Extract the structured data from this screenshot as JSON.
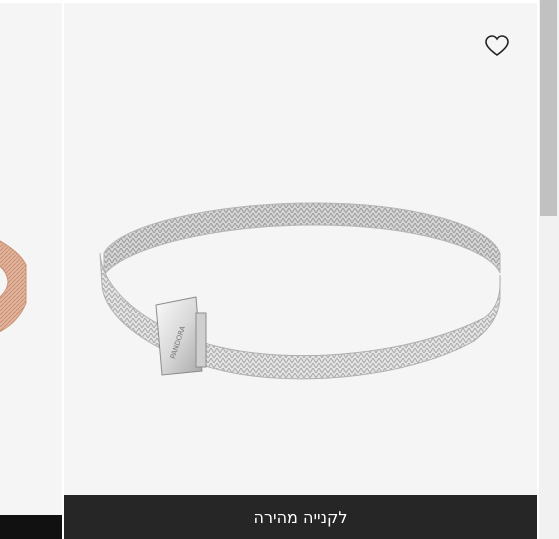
{
  "products": [
    {
      "id_hint": "left",
      "image_icon": "rose-gold-mesh-bracelet-partial",
      "quick_buy_label": ""
    },
    {
      "id_hint": "main",
      "image_icon": "silver-mesh-bracelet",
      "brand_engraving": "PANDORA",
      "wishlist_icon": "heart-outline-icon",
      "quick_buy_label": "לקנייה מהירה"
    }
  ],
  "colors": {
    "card_background": "#f5f5f5",
    "quick_buy_background": "#262626",
    "quick_buy_text": "#ffffff"
  }
}
